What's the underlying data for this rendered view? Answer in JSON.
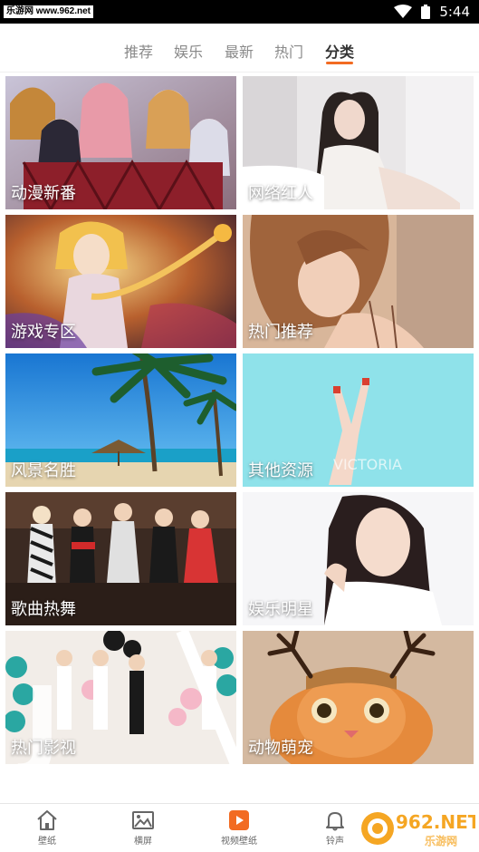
{
  "status_bar": {
    "watermark": "乐游网 www.962.net",
    "time": "5:44"
  },
  "tabs": [
    {
      "label": "推荐",
      "active": false
    },
    {
      "label": "娱乐",
      "active": false
    },
    {
      "label": "最新",
      "active": false
    },
    {
      "label": "热门",
      "active": false
    },
    {
      "label": "分类",
      "active": true
    }
  ],
  "accent_color": "#f26b22",
  "categories": [
    {
      "label": "动漫新番"
    },
    {
      "label": "网络红人"
    },
    {
      "label": "游戏专区"
    },
    {
      "label": "热门推荐"
    },
    {
      "label": "风景名胜"
    },
    {
      "label": "其他资源"
    },
    {
      "label": "歌曲热舞"
    },
    {
      "label": "娱乐明星"
    },
    {
      "label": "热门影视"
    },
    {
      "label": "动物萌宠"
    }
  ],
  "photo_text": {
    "victoria": "VICTORIA"
  },
  "bottom_nav": [
    {
      "label": "壁纸",
      "icon": "home-icon"
    },
    {
      "label": "横屏",
      "icon": "image-icon"
    },
    {
      "label": "视频壁纸",
      "icon": "play-icon"
    },
    {
      "label": "铃声",
      "icon": "bell-icon"
    }
  ],
  "brand_logo": {
    "text": "962.NET",
    "subtext": "乐游网"
  }
}
